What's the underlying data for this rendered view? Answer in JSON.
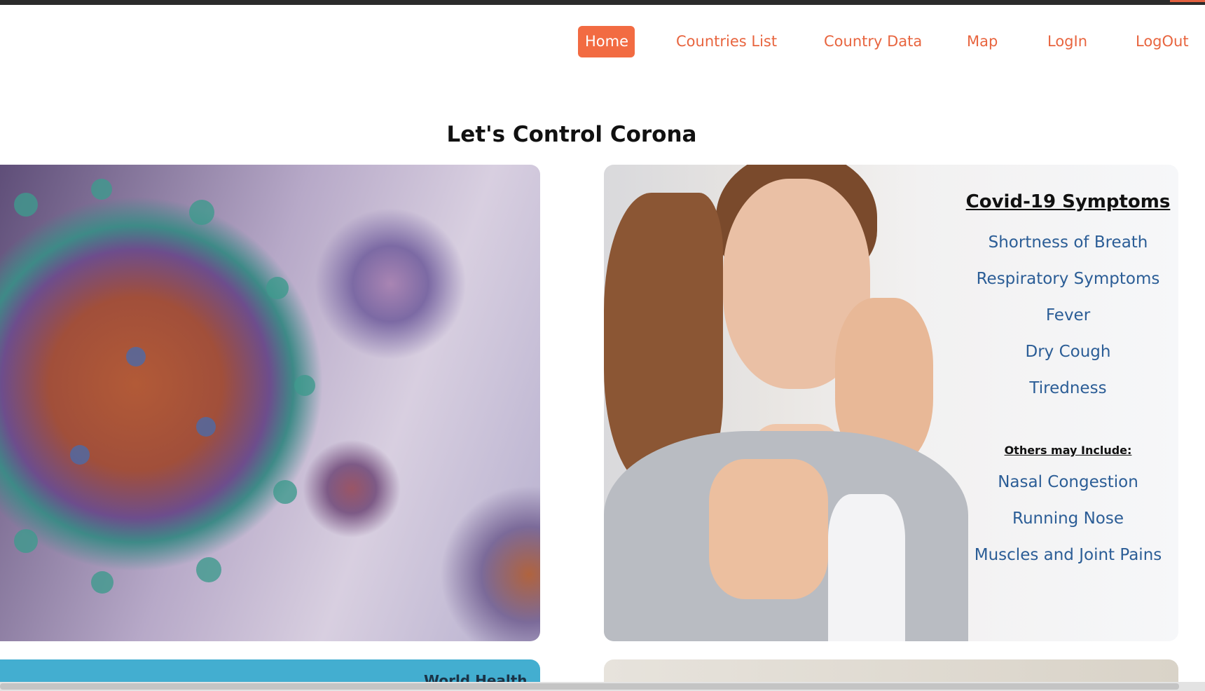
{
  "nav": {
    "home": "Home",
    "countries_list": "Countries List",
    "country_data": "Country Data",
    "map": "Map",
    "login": "LogIn",
    "logout": "LogOut"
  },
  "headline": "Let's Control Corona",
  "symptoms": {
    "title": "Covid-19 Symptoms",
    "items": [
      "Shortness of Breath",
      "Respiratory Symptoms",
      "Fever",
      "Dry Cough",
      "Tiredness"
    ],
    "others_title": "Others may Include:",
    "others": [
      "Nasal Congestion",
      "Running Nose",
      "Muscles and Joint Pains"
    ]
  },
  "who_card": {
    "text": "World Health"
  },
  "colors": {
    "accent": "#f26b42",
    "symptom_text": "#2b5d96",
    "who_blue": "#43aed0"
  }
}
